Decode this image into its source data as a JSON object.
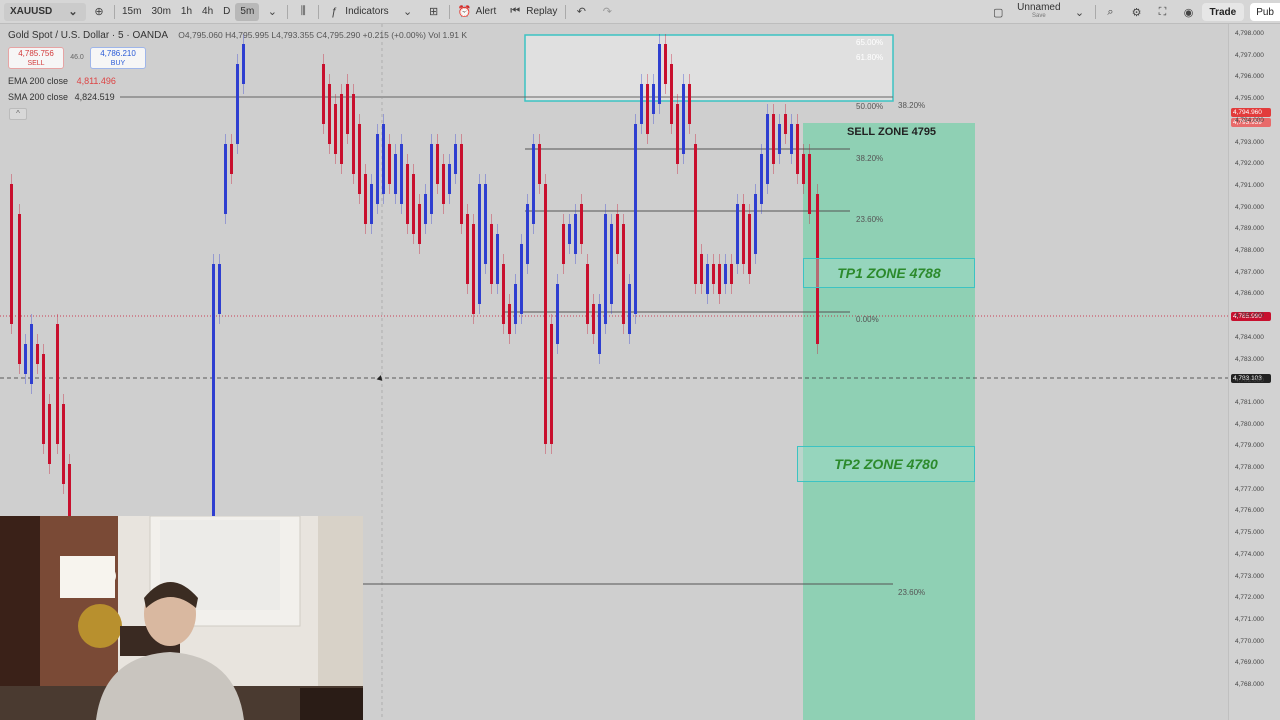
{
  "toolbar": {
    "symbol": "XAUUSD",
    "timeframes": [
      "15m",
      "30m",
      "1h",
      "4h",
      "D",
      "5m"
    ],
    "active_timeframe": "5m",
    "indicators_label": "Indicators",
    "alert_label": "Alert",
    "replay_label": "Replay",
    "layout_name": "Unnamed",
    "layout_sub": "Save",
    "trade_label": "Trade",
    "publish_label": "Pub"
  },
  "legend": {
    "title": "Gold Spot / U.S. Dollar · 5 · OANDA",
    "ohlc": "O4,795.060  H4,795.995  L4,793.355  C4,795.290  +0.215 (+0.00%)  Vol 1.91 K",
    "sell_price": "4,785.756",
    "sell_label": "SELL",
    "spread": "46.0",
    "buy_price": "4,786.210",
    "buy_label": "BUY",
    "ema_label": "EMA 200 close",
    "ema_value": "4,811.496",
    "sma_label": "SMA 200 close",
    "sma_value": "4,824.519"
  },
  "zones": {
    "sell": "SELL ZONE 4795",
    "tp1": "TP1 ZONE 4788",
    "tp2": "TP2 ZONE 4780"
  },
  "fib_labels": {
    "top_a": "65.00%",
    "top_b": "61.80%",
    "f50": "50.00%",
    "f382_right": "38.20%",
    "f382": "38.20%",
    "f236": "23.60%",
    "f0": "0.00%",
    "f236_low": "23.60%"
  },
  "price_scale": {
    "labels": [
      "4,798.000",
      "4,797.000",
      "4,796.000",
      "4,795.000",
      "4,794.000",
      "4,793.000",
      "4,792.000",
      "4,791.000",
      "4,790.000",
      "4,789.000",
      "4,788.000",
      "4,787.000",
      "4,786.000",
      "4,785.000",
      "4,784.000",
      "4,783.000",
      "4,782.000",
      "4,781.000",
      "4,780.000",
      "4,779.000",
      "4,778.000",
      "4,777.000",
      "4,776.000",
      "4,775.000",
      "4,774.000",
      "4,773.000",
      "4,772.000",
      "4,771.000",
      "4,770.000",
      "4,769.000",
      "4,768.000"
    ],
    "tag_sell": "4,794.960",
    "tag_sell2": "4,795.959",
    "tag_current": "4,785.990",
    "tag_cursor": "4,783.103"
  },
  "colors": {
    "up_candle": "#2f3fd0",
    "down_candle": "#c8102e",
    "zone_fill": "#8fd0b4",
    "zone_border": "#3cc3c3"
  }
}
